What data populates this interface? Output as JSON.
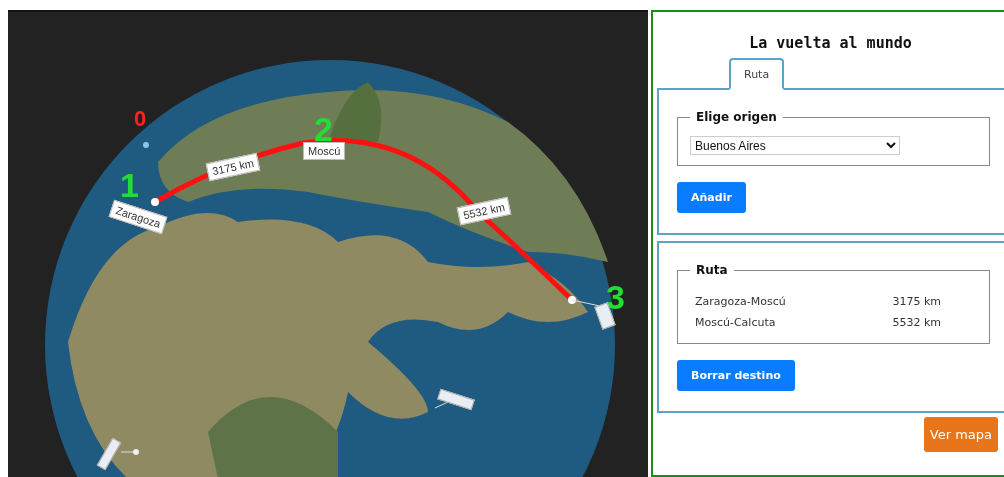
{
  "globe": {
    "markers": [
      {
        "number": "0",
        "color": "#ff2020"
      },
      {
        "number": "1",
        "color": "#22dd33",
        "label": "Zaragoza"
      },
      {
        "number": "2",
        "color": "#22dd33",
        "label": "Moscú"
      },
      {
        "number": "3",
        "color": "#22dd33"
      }
    ],
    "distances": [
      "3175 km",
      "5532 km"
    ]
  },
  "panel": {
    "title": "La vuelta al mundo",
    "tabs": [
      {
        "label": "Ruta",
        "selected": true
      }
    ],
    "origin": {
      "legend": "Elige origen",
      "value": "Buenos Aires"
    },
    "add_button": "Añadir",
    "route": {
      "legend": "Ruta",
      "rows": [
        {
          "segment": "Zaragoza-Moscú",
          "distance": "3175 km"
        },
        {
          "segment": "Moscú-Calcuta",
          "distance": "5532 km"
        }
      ]
    },
    "clear_button": "Borrar destino",
    "map_button": "Ver mapa"
  }
}
